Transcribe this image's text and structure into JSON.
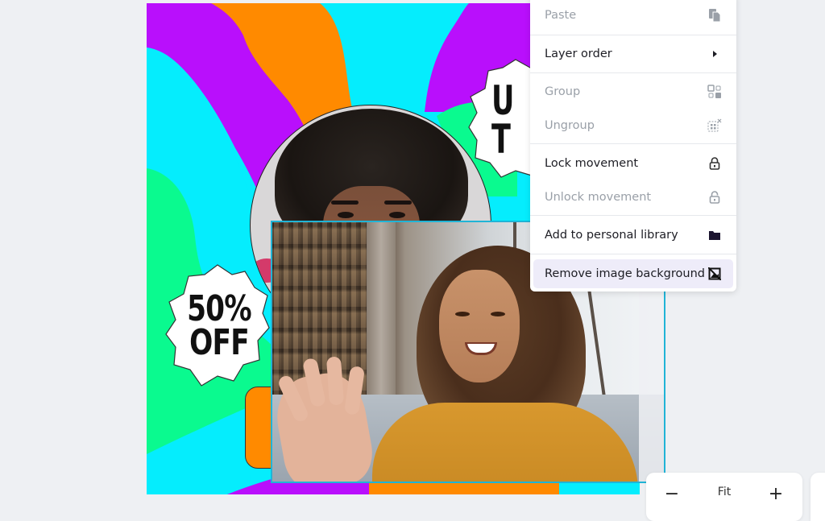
{
  "canvas": {
    "colors": {
      "purple": "#b90ffc",
      "orange": "#ff8a00",
      "cyan": "#05edfd",
      "green": "#0afa8f",
      "selection": "#20b4d6"
    },
    "badges": [
      {
        "line1": "50%",
        "line2": "OFF"
      },
      {
        "line1": "U",
        "line2": "T"
      }
    ]
  },
  "context_menu": {
    "items": [
      {
        "label": "Paste",
        "icon": "paste-icon",
        "disabled": true
      },
      {
        "label": "Layer order",
        "icon": "submenu-arrow-icon",
        "disabled": false
      },
      {
        "label": "Group",
        "icon": "group-icon",
        "disabled": true
      },
      {
        "label": "Ungroup",
        "icon": "ungroup-icon",
        "disabled": true
      },
      {
        "label": "Lock movement",
        "icon": "lock-icon",
        "disabled": false
      },
      {
        "label": "Unlock movement",
        "icon": "unlock-icon",
        "disabled": true
      },
      {
        "label": "Add to personal library",
        "icon": "folder-icon",
        "disabled": false
      },
      {
        "label": "Remove image background",
        "icon": "remove-background-icon",
        "disabled": false,
        "hovered": true
      }
    ]
  },
  "zoom_control": {
    "minus": "−",
    "fit_label": "Fit",
    "plus": "+"
  }
}
